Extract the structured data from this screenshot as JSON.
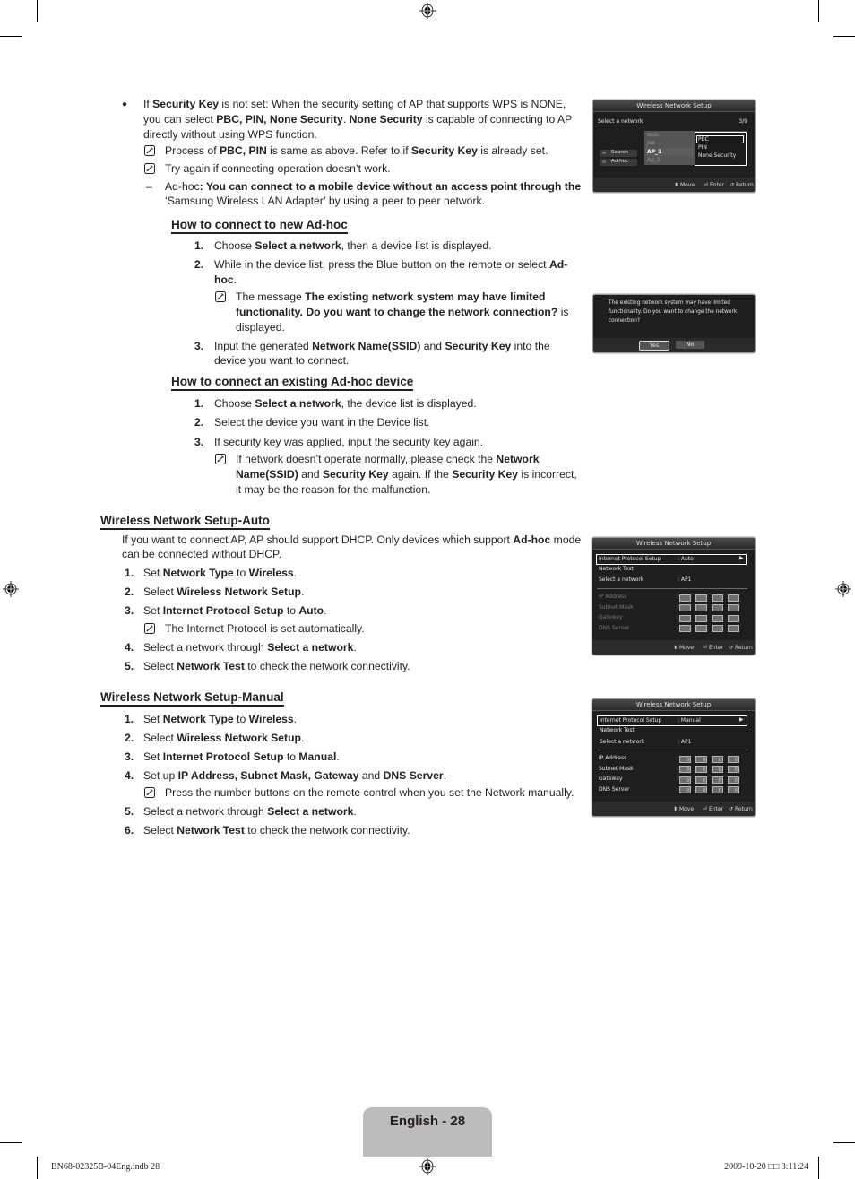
{
  "section_wps": {
    "bullet_line1": [
      "If ",
      "Security Key",
      " is not set: When the security setting of AP that supports WPS is NONE,"
    ],
    "bullet_line2": [
      "you can select ",
      "PBC, PIN, None Security",
      ". ",
      "None Security",
      " is capable of connecting to AP"
    ],
    "bullet_line3": "directly without using WPS function.",
    "note1": [
      "Process of ",
      "PBC, PIN",
      " is same as above. Refer to if ",
      "Security Key",
      " is already set."
    ],
    "note2": "Try again if connecting operation doesn’t work.",
    "dash_line1": [
      "Ad-hoc",
      ": You can connect to a mobile device without an access point through the"
    ],
    "dash_line2": "‘Samsung Wireless LAN Adapter’ by using a peer to peer network."
  },
  "section_new_adhoc": {
    "heading": "How to connect to new Ad-hoc",
    "steps": [
      {
        "num": "1.",
        "lines": [
          [
            "Choose ",
            "Select a network",
            ", then a device list is displayed."
          ]
        ]
      },
      {
        "num": "2.",
        "lines": [
          [
            "While in the device list, press the Blue button on the remote or select ",
            "Ad-"
          ],
          [
            "",
            "hoc",
            "."
          ]
        ]
      },
      {
        "num": "3.",
        "lines": [
          [
            "Input the generated ",
            "Network Name(SSID)",
            " and ",
            "Security Key",
            " into the"
          ],
          [
            "device you want to connect."
          ]
        ]
      }
    ],
    "note": [
      [
        "The message ",
        "The existing network system may have limited"
      ],
      [
        "",
        "functionality. Do you want to change the network connection?",
        " is"
      ],
      [
        "displayed."
      ]
    ]
  },
  "section_existing_adhoc": {
    "heading": "How to connect an existing Ad-hoc device",
    "steps": [
      {
        "num": "1.",
        "lines": [
          [
            "Choose ",
            "Select a network",
            ", the device list is displayed."
          ]
        ]
      },
      {
        "num": "2.",
        "lines": [
          [
            "Select the device you want in the Device list."
          ]
        ]
      },
      {
        "num": "3.",
        "lines": [
          [
            "If security key was applied, input the security key again."
          ]
        ]
      }
    ],
    "note": [
      [
        "If network doesn’t operate normally, please check the ",
        "Network"
      ],
      [
        "",
        "Name(SSID)",
        " and ",
        "Security Key",
        " again. If the ",
        "Security Key",
        " is incorrect,"
      ],
      [
        "it may be the reason for the malfunction."
      ]
    ]
  },
  "section_auto": {
    "heading": "Wireless Network Setup-Auto",
    "intro": [
      [
        "If you want to connect AP, AP should support DHCP. Only devices which support ",
        "Ad-hoc",
        " mode"
      ],
      [
        "can be connected without DHCP."
      ]
    ],
    "steps": [
      {
        "num": "1.",
        "parts": [
          "Set ",
          "Network Type",
          " to ",
          "Wireless",
          "."
        ]
      },
      {
        "num": "2.",
        "parts": [
          "Select ",
          "Wireless Network Setup",
          "."
        ]
      },
      {
        "num": "3.",
        "parts": [
          "Set ",
          "Internet Protocol Setup",
          " to ",
          "Auto",
          "."
        ]
      },
      {
        "num": "4.",
        "parts": [
          "Select a network through ",
          "Select a network",
          "."
        ]
      },
      {
        "num": "5.",
        "parts": [
          "Select ",
          "Network Test",
          " to check the network connectivity."
        ]
      }
    ],
    "note": "The Internet Protocol is set automatically."
  },
  "section_manual": {
    "heading": "Wireless Network Setup-Manual",
    "steps": [
      {
        "num": "1.",
        "parts": [
          "Set ",
          "Network Type",
          " to ",
          "Wireless",
          "."
        ]
      },
      {
        "num": "2.",
        "parts": [
          "Select ",
          "Wireless Network Setup",
          "."
        ]
      },
      {
        "num": "3.",
        "parts": [
          "Set ",
          "Internet Protocol Setup",
          " to ",
          "Manual",
          "."
        ]
      },
      {
        "num": "4.",
        "parts": [
          "Set up ",
          "IP Address, Subnet Mask, Gateway",
          " and ",
          "DNS Server",
          "."
        ]
      },
      {
        "num": "5.",
        "parts": [
          "Select a network through ",
          "Select a network",
          "."
        ]
      },
      {
        "num": "6.",
        "parts": [
          "Select ",
          "Network Test",
          " to check the network connectivity."
        ]
      }
    ],
    "note": "Press the number buttons on the remote control when you set the Network manually."
  },
  "screen_wps": {
    "title": "Wireless Network Setup",
    "label": "Select a network",
    "page": "3/9",
    "networks": [
      "sson",
      "jee",
      "AP_1",
      "Ap_2"
    ],
    "options": [
      "PBC",
      "PIN",
      "None Security"
    ],
    "buttons": [
      "Search",
      "Ad-hoc"
    ],
    "footer": {
      "move": "Move",
      "enter": "Enter",
      "return": "Return"
    }
  },
  "screen_dialog": {
    "message": [
      "The existing network system may have limited",
      "functionality. Do you want to change the network",
      "connection?"
    ],
    "yes": "Yes",
    "no": "No"
  },
  "screen_auto": {
    "title": "Wireless Network Setup",
    "rows": [
      {
        "label": "Internet Protocol Setup",
        "value": ": Auto"
      },
      {
        "label": "Network Test",
        "value": ""
      },
      {
        "label": "Select a network",
        "value": ": AP1"
      }
    ],
    "ip_rows": [
      "IP Address",
      "Subnet Mask",
      "Gateway",
      "DNS Server"
    ],
    "footer": {
      "move": "Move",
      "enter": "Enter",
      "return": "Return"
    }
  },
  "screen_manual": {
    "title": "Wireless Network Setup",
    "rows": [
      {
        "label": "Internet Protocol Setup",
        "value": ": Manual"
      },
      {
        "label": "Network Test",
        "value": ""
      },
      {
        "label": "Select a network",
        "value": ": AP1"
      }
    ],
    "ip_rows": [
      "IP Address",
      "Subnet Mask",
      "Gateway",
      "DNS Server"
    ],
    "ip_value": "0",
    "footer": {
      "move": "Move",
      "enter": "Enter",
      "return": "Return"
    }
  },
  "page_footer": {
    "page_label": "English - 28",
    "slug_left": "BN68-02325B-04Eng.indb   28",
    "slug_right": "2009-10-20   □□ 3:11:24"
  }
}
